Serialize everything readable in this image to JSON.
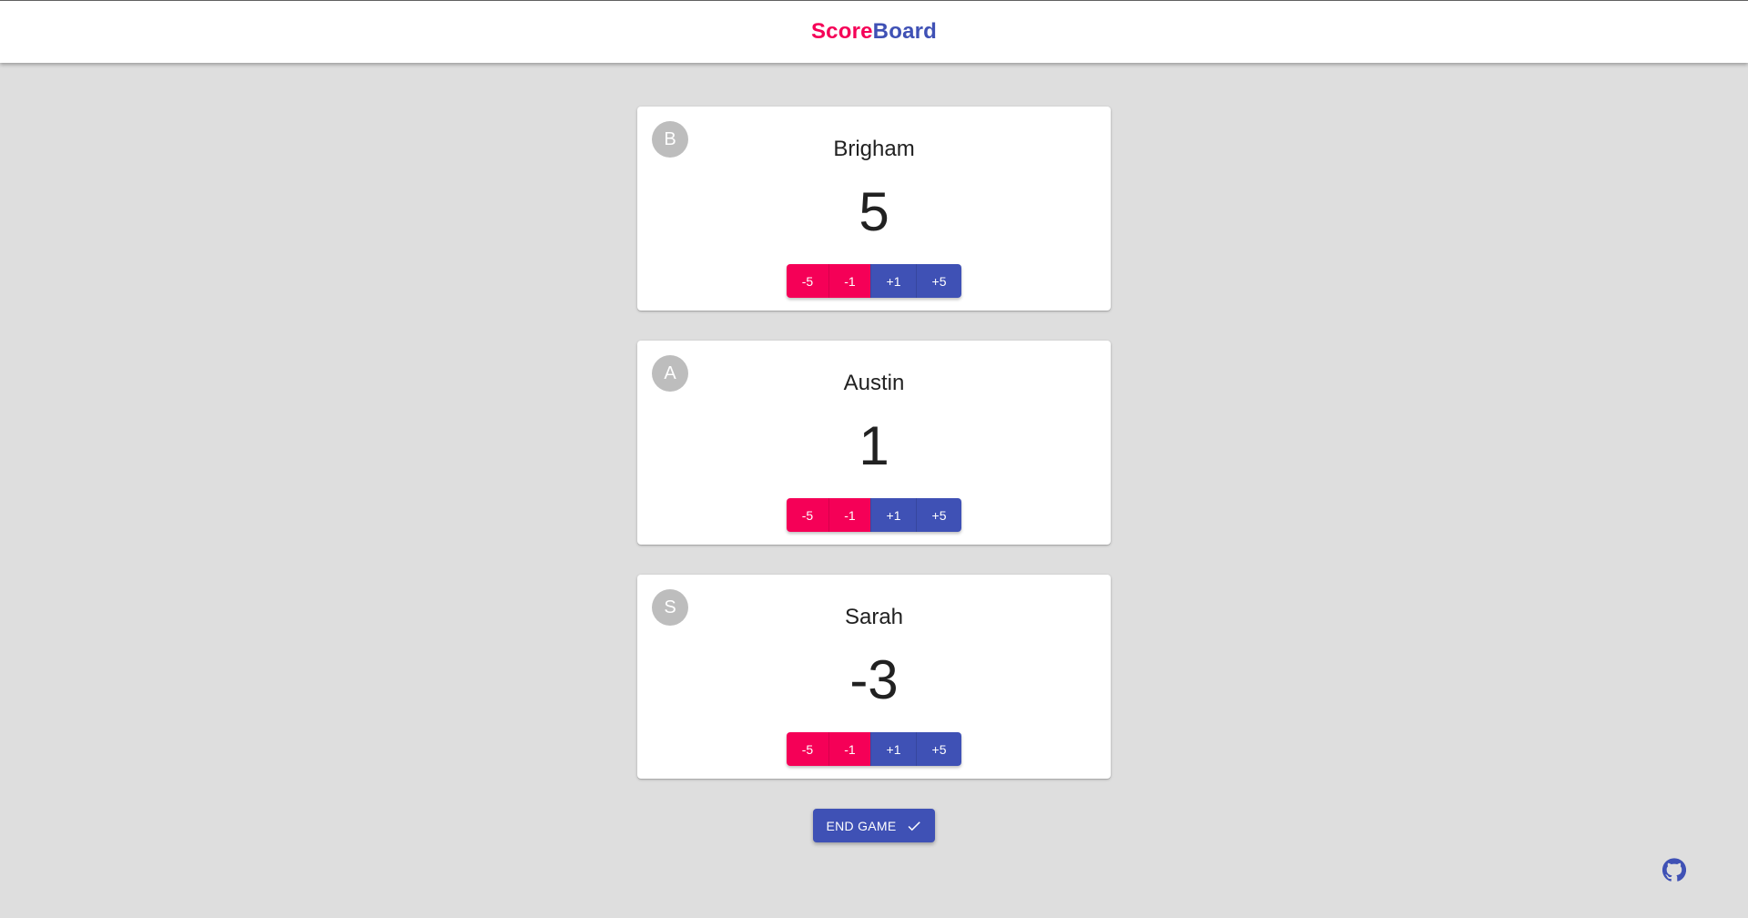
{
  "app": {
    "title_part1": "Score",
    "title_part2": "Board"
  },
  "players": [
    {
      "initial": "B",
      "name": "Brigham",
      "score": "5"
    },
    {
      "initial": "A",
      "name": "Austin",
      "score": "1"
    },
    {
      "initial": "S",
      "name": "Sarah",
      "score": "-3"
    }
  ],
  "score_buttons": {
    "minus5": "-5",
    "minus1": "-1",
    "plus1": "+1",
    "plus5": "+5"
  },
  "actions": {
    "end_game_label": "END GAME",
    "end_game_icon": "check-icon",
    "github_icon": "github-icon"
  },
  "colors": {
    "accent_pink": "#f50057",
    "primary_indigo": "#3f51b5",
    "background": "#dedede",
    "avatar_gray": "#bdbdbd"
  }
}
